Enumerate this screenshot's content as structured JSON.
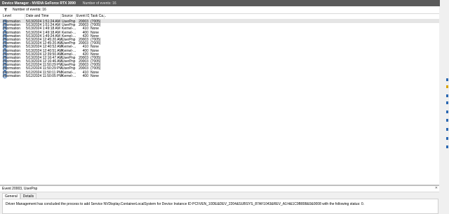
{
  "titlebar": {
    "title": "Device Manager - NVIDIA GeForce RTX 3090",
    "count_label": "Number of events: 16"
  },
  "filter": {
    "label": "Number of events: 16"
  },
  "columns": {
    "level": "Level",
    "date": "Date and Time",
    "source": "Source",
    "event_id": "Event ID",
    "task": "Task Ca..."
  },
  "events": [
    {
      "level": "Information",
      "date": "5/13/2024 1:51:24 AM",
      "source": "UserPnp",
      "event_id": "20003",
      "task": "(7005)"
    },
    {
      "level": "Information",
      "date": "5/13/2024 1:51:24 AM",
      "source": "UserPnp",
      "event_id": "20003",
      "task": "(7005)"
    },
    {
      "level": "Information",
      "date": "5/13/2024 1:49:18 AM",
      "source": "Kernel-...",
      "event_id": "410",
      "task": "None"
    },
    {
      "level": "Information",
      "date": "5/13/2024 1:49:18 AM",
      "source": "Kernel-...",
      "event_id": "400",
      "task": "None"
    },
    {
      "level": "Information",
      "date": "5/13/2024 1:49:24 AM",
      "source": "Kernel-...",
      "event_id": "420",
      "task": "None"
    },
    {
      "level": "Information",
      "date": "5/13/2024 12:45:20 AM",
      "source": "UserPnp",
      "event_id": "20003",
      "task": "(7005)"
    },
    {
      "level": "Information",
      "date": "5/13/2024 12:45:20 AM",
      "source": "UserPnp",
      "event_id": "20003",
      "task": "(7005)"
    },
    {
      "level": "Information",
      "date": "5/13/2024 12:40:52 AM",
      "source": "Kernel-...",
      "event_id": "410",
      "task": "None"
    },
    {
      "level": "Information",
      "date": "5/13/2024 12:40:51 AM",
      "source": "Kernel-...",
      "event_id": "400",
      "task": "None"
    },
    {
      "level": "Information",
      "date": "5/13/2024 12:39:50 AM",
      "source": "Kernel-...",
      "event_id": "420",
      "task": "None"
    },
    {
      "level": "Information",
      "date": "5/13/2024 12:16:47 AM",
      "source": "UserPnp",
      "event_id": "20003",
      "task": "(7005)"
    },
    {
      "level": "Information",
      "date": "5/13/2024 12:16:46 AM",
      "source": "UserPnp",
      "event_id": "20003",
      "task": "(7005)"
    },
    {
      "level": "Information",
      "date": "5/12/2024 11:50:29 PM",
      "source": "UserPnp",
      "event_id": "20003",
      "task": "(7005)"
    },
    {
      "level": "Information",
      "date": "5/12/2024 11:50:29 PM",
      "source": "UserPnp",
      "event_id": "20003",
      "task": "(7005)"
    },
    {
      "level": "Information",
      "date": "5/12/2024 11:50:11 PM",
      "source": "Kernel-...",
      "event_id": "410",
      "task": "None"
    },
    {
      "level": "Information",
      "date": "5/12/2024 11:50:05 PM",
      "source": "Kernel-...",
      "event_id": "400",
      "task": "None"
    }
  ],
  "detail": {
    "header": "Event 20003, UserPnp",
    "tabs": [
      "General",
      "Details"
    ],
    "message": "Driver Management has concluded the process to add Service NVDisplay.ContainerLocalSystem for Device Instance ID PCI\\VEN_10DE&DEV_2204&SUBSYS_87AF1043&REV_A1\\4&1C9B808&0&0008 with the following status: 0."
  },
  "icons": {
    "filter": "filter-icon",
    "info": "information-icon",
    "close": "close-icon"
  },
  "colors": {
    "titlebar": "#5a5a5a",
    "selected_row": "#e5e5e5",
    "info_icon": "#2a67b1"
  }
}
